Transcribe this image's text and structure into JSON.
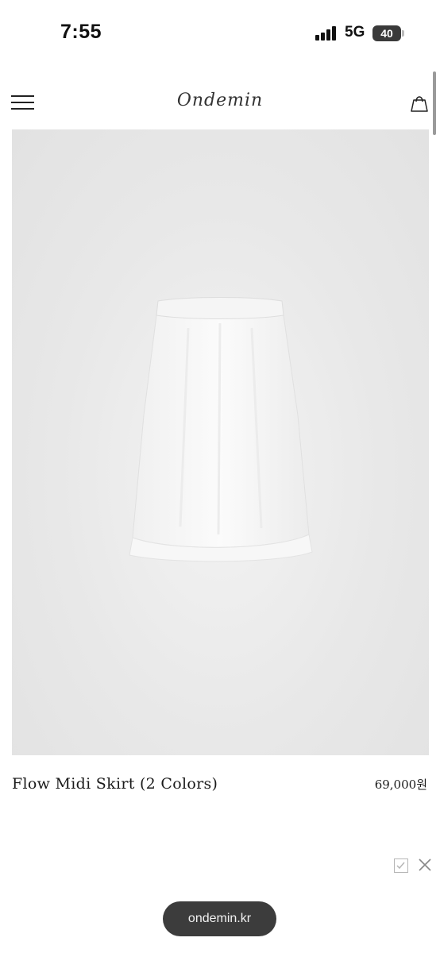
{
  "status_bar": {
    "time": "7:55",
    "network": "5G",
    "battery": "40"
  },
  "header": {
    "logo": "Ondemin",
    "menu_icon": "hamburger-menu-icon",
    "cart_icon": "shopping-bag-icon"
  },
  "product": {
    "name": "Flow Midi Skirt (2 Colors)",
    "price": "69,000원"
  },
  "overlay": {
    "check_icon": "checkbox-icon",
    "close_icon": "close-icon"
  },
  "browser": {
    "url": "ondemin.kr"
  }
}
